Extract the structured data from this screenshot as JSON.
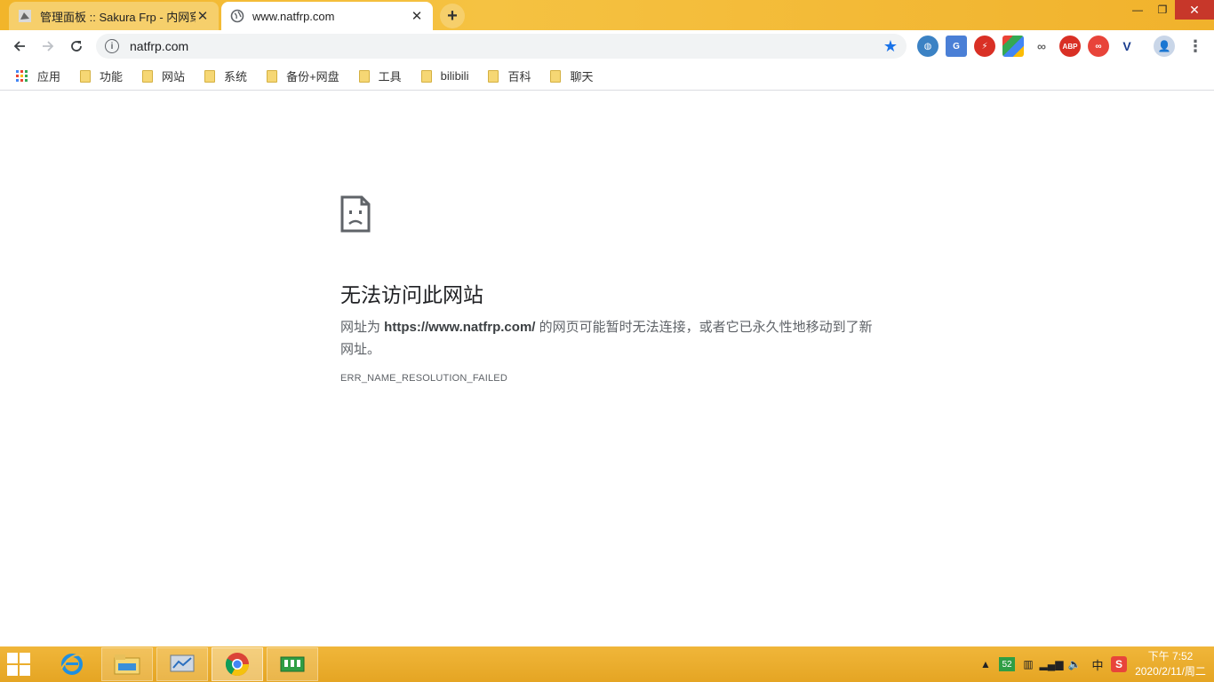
{
  "tabs": [
    {
      "title": "管理面板 :: Sakura Frp - 内网穿透",
      "active": false
    },
    {
      "title": "www.natfrp.com",
      "active": true
    }
  ],
  "address_bar": {
    "url": "natfrp.com"
  },
  "bookmarks": [
    {
      "label": "应用",
      "type": "apps"
    },
    {
      "label": "功能",
      "type": "folder"
    },
    {
      "label": "网站",
      "type": "folder"
    },
    {
      "label": "系统",
      "type": "folder"
    },
    {
      "label": "备份+网盘",
      "type": "folder"
    },
    {
      "label": "工具",
      "type": "folder"
    },
    {
      "label": "bilibili",
      "type": "folder"
    },
    {
      "label": "百科",
      "type": "folder"
    },
    {
      "label": "聊天",
      "type": "folder"
    }
  ],
  "error_page": {
    "title": "无法访问此网站",
    "desc_prefix": "网址为 ",
    "desc_url": "https://www.natfrp.com/",
    "desc_suffix": " 的网页可能暂时无法连接，或者它已永久性地移动到了新网址。",
    "code": "ERR_NAME_RESOLUTION_FAILED"
  },
  "extensions": [
    "globe-ext-icon",
    "translate-ext-icon",
    "lightning-ext-icon",
    "puzzle-ext-icon",
    "link-ext-icon",
    "abp-ext-icon",
    "infinity-ext-icon",
    "v-ext-icon"
  ],
  "extension_labels": {
    "abp": "ABP"
  },
  "taskbar": {
    "clock_time": "下午 7:52",
    "clock_date": "2020/2/11/周二",
    "tray_battery": "52",
    "tray_ime": "中",
    "tray_sogou": "S"
  },
  "colors": {
    "frame": "#f1b22c",
    "accent_blue": "#1a73e8",
    "error_title": "#202124"
  }
}
